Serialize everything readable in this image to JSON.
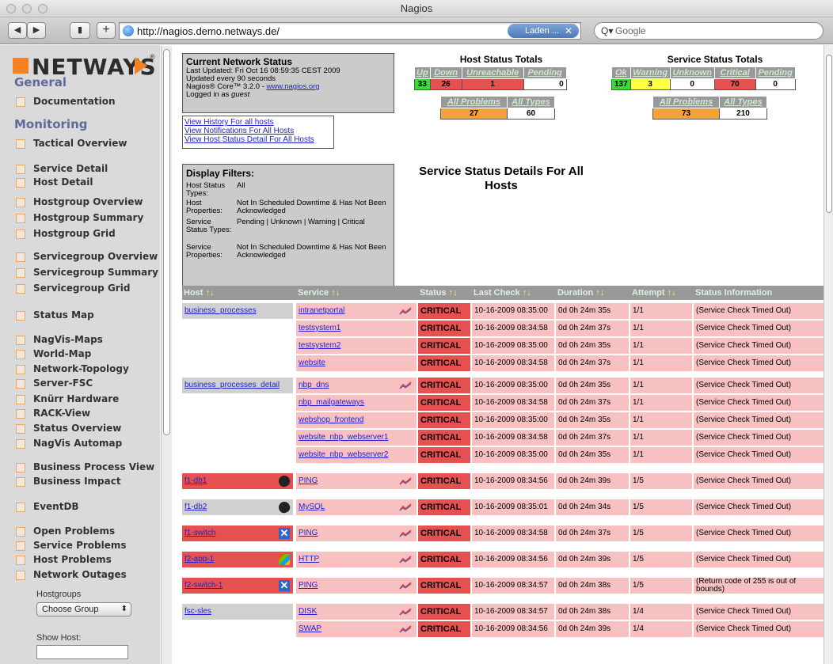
{
  "window": {
    "title": "Nagios"
  },
  "toolbar": {
    "back": "◀",
    "forward": "▶",
    "add": "+",
    "url": "http://nagios.demo.netways.de/",
    "loading_label": "Laden ...",
    "loading_close": "✕",
    "search_placeholder": "Google",
    "search_icon": "Q▾"
  },
  "sidebar": {
    "logo_text": "NETWAYS",
    "logo_reg": "®",
    "sections": [
      {
        "title": "General",
        "items": [
          {
            "label": "Documentation"
          }
        ]
      },
      {
        "title": "Monitoring",
        "items": [
          {
            "label": "Tactical Overview"
          },
          {
            "label": "Service Detail"
          },
          {
            "label": "Host Detail"
          },
          {
            "label": "Hostgroup Overview"
          },
          {
            "label": "Hostgroup Summary"
          },
          {
            "label": "Hostgroup Grid"
          },
          {
            "label": "Servicegroup Overview"
          },
          {
            "label": "Servicegroup Summary"
          },
          {
            "label": "Servicegroup Grid"
          },
          {
            "label": "Status Map"
          },
          {
            "label": "NagVis-Maps"
          },
          {
            "label": "World-Map"
          },
          {
            "label": "Network-Topology"
          },
          {
            "label": "Server-FSC"
          },
          {
            "label": "Knürr Hardware"
          },
          {
            "label": "RACK-View"
          },
          {
            "label": "Status Overview"
          },
          {
            "label": "NagVis Automap"
          },
          {
            "label": "Business Process View"
          },
          {
            "label": "Business Impact"
          },
          {
            "label": "EventDB"
          },
          {
            "label": "Open Problems"
          },
          {
            "label": "Service Problems"
          },
          {
            "label": "Host Problems"
          },
          {
            "label": "Network Outages"
          }
        ]
      }
    ],
    "hostgroups_label": "Hostgroups",
    "choose_group": "Choose Group",
    "choose_arrow": "⬍",
    "show_host_label": "Show Host:"
  },
  "status": {
    "title": "Current Network Status",
    "last_updated": "Last Updated: Fri Oct 16 08:59:35 CEST 2009",
    "update_interval": "Updated every 90 seconds",
    "core_prefix": "Nagios® Core™ 3.2.0 - ",
    "core_link": "www.nagios.org",
    "logged_prefix": "Logged in as ",
    "logged_user": "guest",
    "links": [
      "View History For all hosts",
      "View Notifications For All Hosts",
      "View Host Status Detail For All Hosts"
    ]
  },
  "host_totals": {
    "title": "Host Status Totals",
    "headers": [
      "Up",
      "Down",
      "Unreachable",
      "Pending"
    ],
    "values": [
      "33",
      "26",
      "1",
      "0"
    ],
    "summary_headers": [
      "All Problems",
      "All Types"
    ],
    "summary_values": [
      "27",
      "60"
    ]
  },
  "service_totals": {
    "title": "Service Status Totals",
    "headers": [
      "Ok",
      "Warning",
      "Unknown",
      "Critical",
      "Pending"
    ],
    "values": [
      "137",
      "3",
      "0",
      "70",
      "0"
    ],
    "summary_headers": [
      "All Problems",
      "All Types"
    ],
    "summary_values": [
      "73",
      "210"
    ]
  },
  "heading": "Service Status Details For All Hosts",
  "filters": {
    "title": "Display Filters:",
    "rows": [
      {
        "key": "Host Status Types:",
        "value": "All"
      },
      {
        "key": "Host Properties:",
        "value": "Not In Scheduled Downtime & Has Not Been Acknowledged"
      },
      {
        "key": "Service Status Types:",
        "value": "Pending | Unknown | Warning | Critical"
      },
      {
        "key": "Service Properties:",
        "value": "Not In Scheduled Downtime & Has Not Been Acknowledged"
      }
    ]
  },
  "table": {
    "columns": [
      "Host",
      "Service",
      "Status",
      "Last Check",
      "Duration",
      "Attempt",
      "Status Information"
    ],
    "sort_arrows": "↑↓",
    "rows": [
      {
        "host": "business_processes",
        "service": "intranetportal",
        "status": "CRITICAL",
        "last": "10-16-2009 08:35:00",
        "dur": "0d 0h 24m 35s",
        "att": "1/1",
        "info": "(Service Check Timed Out)"
      },
      {
        "host": "",
        "service": "testsystem1",
        "status": "CRITICAL",
        "last": "10-16-2009 08:34:58",
        "dur": "0d 0h 24m 37s",
        "att": "1/1",
        "info": "(Service Check Timed Out)"
      },
      {
        "host": "",
        "service": "testsystem2",
        "status": "CRITICAL",
        "last": "10-16-2009 08:35:00",
        "dur": "0d 0h 24m 35s",
        "att": "1/1",
        "info": "(Service Check Timed Out)"
      },
      {
        "host": "",
        "service": "website",
        "status": "CRITICAL",
        "last": "10-16-2009 08:34:58",
        "dur": "0d 0h 24m 37s",
        "att": "1/1",
        "info": "(Service Check Timed Out)"
      },
      {
        "host": "business_processes_detail",
        "service": "nbp_dns",
        "status": "CRITICAL",
        "last": "10-16-2009 08:35:00",
        "dur": "0d 0h 24m 35s",
        "att": "1/1",
        "info": "(Service Check Timed Out)"
      },
      {
        "host": "",
        "service": "nbp_mailgateways",
        "status": "CRITICAL",
        "last": "10-16-2009 08:34:58",
        "dur": "0d 0h 24m 37s",
        "att": "1/1",
        "info": "(Service Check Timed Out)"
      },
      {
        "host": "",
        "service": "webshop_frontend",
        "status": "CRITICAL",
        "last": "10-16-2009 08:35:00",
        "dur": "0d 0h 24m 35s",
        "att": "1/1",
        "info": "(Service Check Timed Out)"
      },
      {
        "host": "",
        "service": "website_nbp_webserver1",
        "status": "CRITICAL",
        "last": "10-16-2009 08:34:58",
        "dur": "0d 0h 24m 37s",
        "att": "1/1",
        "info": "(Service Check Timed Out)"
      },
      {
        "host": "",
        "service": "website_nbp_webserver2",
        "status": "CRITICAL",
        "last": "10-16-2009 08:35:00",
        "dur": "0d 0h 24m 35s",
        "att": "1/1",
        "info": "(Service Check Timed Out)"
      },
      {
        "host": "f1-db1",
        "service": "PING",
        "status": "CRITICAL",
        "last": "10-16-2009 08:34:56",
        "dur": "0d 0h 24m 39s",
        "att": "1/5",
        "info": "(Service Check Timed Out)"
      },
      {
        "host": "f1-db2",
        "service": "MySQL",
        "status": "CRITICAL",
        "last": "10-16-2009 08:35:01",
        "dur": "0d 0h 24m 34s",
        "att": "1/5",
        "info": "(Service Check Timed Out)"
      },
      {
        "host": "f1-switch",
        "service": "PING",
        "status": "CRITICAL",
        "last": "10-16-2009 08:34:58",
        "dur": "0d 0h 24m 37s",
        "att": "1/5",
        "info": "(Service Check Timed Out)"
      },
      {
        "host": "f2-app-1",
        "service": "HTTP",
        "status": "CRITICAL",
        "last": "10-16-2009 08:34:56",
        "dur": "0d 0h 24m 39s",
        "att": "1/5",
        "info": "(Service Check Timed Out)"
      },
      {
        "host": "f2-switch-1",
        "service": "PING",
        "status": "CRITICAL",
        "last": "10-16-2009 08:34:57",
        "dur": "0d 0h 24m 38s",
        "att": "1/5",
        "info": "(Return code of 255 is out of bounds)"
      },
      {
        "host": "fsc-sles",
        "service": "DISK",
        "status": "CRITICAL",
        "last": "10-16-2009 08:34:57",
        "dur": "0d 0h 24m 38s",
        "att": "1/4",
        "info": "(Service Check Timed Out)"
      },
      {
        "host": "",
        "service": "SWAP",
        "status": "CRITICAL",
        "last": "10-16-2009 08:34:56",
        "dur": "0d 0h 24m 39s",
        "att": "1/4",
        "info": "(Service Check Timed Out)"
      }
    ]
  },
  "colors": {
    "critical": "#e55151",
    "critical_light": "#f7c1c1",
    "up": "#33dd33",
    "warning": "#ffff44",
    "problems": "#f5a23a",
    "accent": "#f58220"
  }
}
